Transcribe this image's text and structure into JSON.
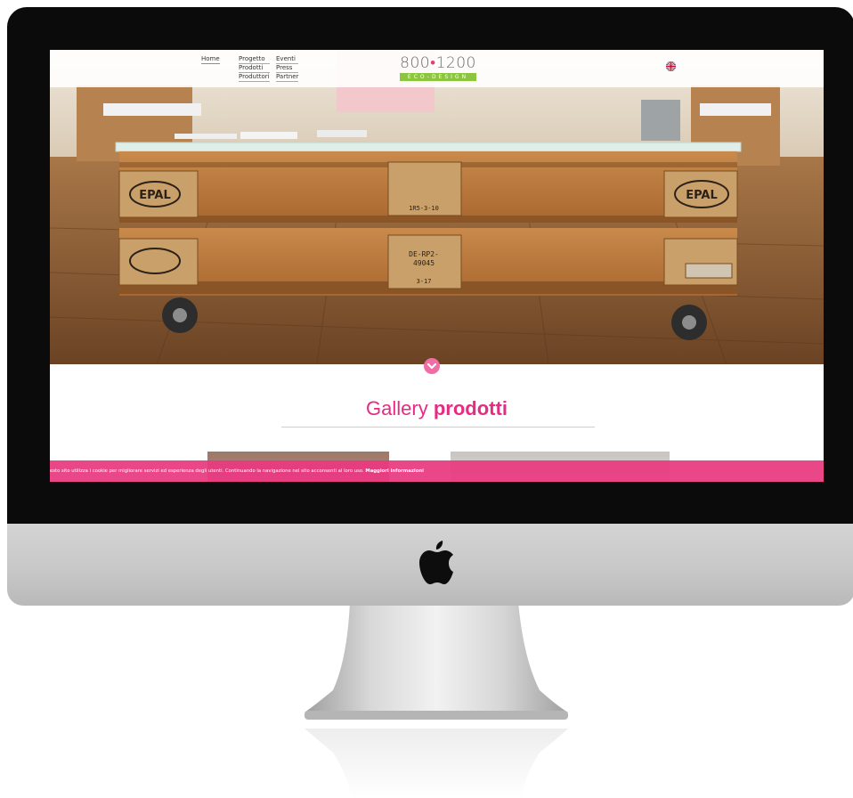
{
  "nav": {
    "home": "Home",
    "col2": [
      "Progetto",
      "Prodotti",
      "Produttori"
    ],
    "col3": [
      "Eventi",
      "Press",
      "Partner"
    ]
  },
  "logo": {
    "left": "800",
    "dot": "•",
    "right": "1200",
    "sub": "ECO-DESIGN"
  },
  "language_flag": "uk-flag-icon",
  "hero": {
    "pallet_labels": [
      "EPAL",
      "EPAL",
      "EPAL"
    ],
    "stamp_text": [
      "DE-RP2-",
      "49045",
      "1R5-3-10",
      "3-17"
    ]
  },
  "section": {
    "title_regular": "Gallery",
    "title_bold": "prodotti"
  },
  "cookie": {
    "text": "esto sito utilizza i cookie per migliorare servizi ed esperienza degli utenti. Continuando la navigazione nel sito acconsenti al loro uso. ",
    "link": "Maggiori informazioni"
  },
  "colors": {
    "accent": "#e42c83",
    "cookie_bar": "#e83980",
    "nav_underline": "#8cc63f"
  }
}
